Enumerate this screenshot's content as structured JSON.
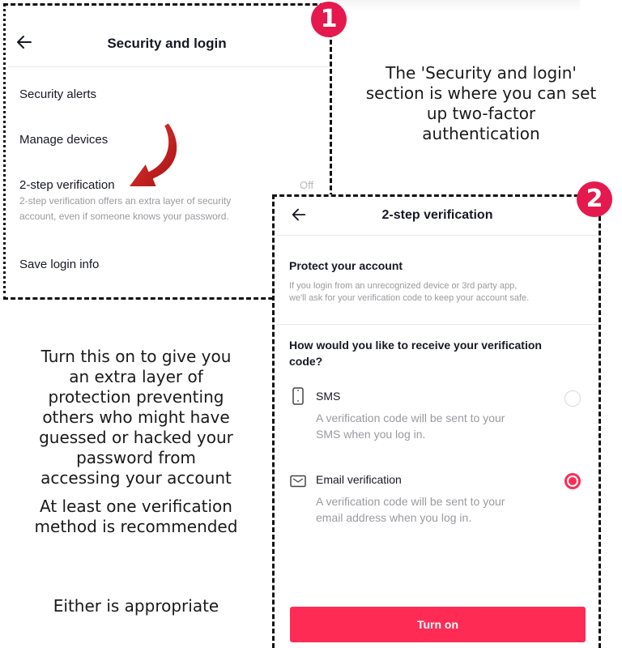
{
  "screen1": {
    "title": "Security and login",
    "items": [
      {
        "label": "Security alerts"
      },
      {
        "label": "Manage devices"
      },
      {
        "label": "2-step verification",
        "value": "Off",
        "description_line1": "2-step verification offers an extra layer of security",
        "description_line2": "account, even if someone knows your password."
      },
      {
        "label": "Save login info"
      }
    ]
  },
  "badges": {
    "one": "1",
    "two": "2"
  },
  "captions": {
    "security_section": [
      "The 'Security and login'",
      "section is where you can set",
      "up two-factor",
      "authentication"
    ],
    "turn_on_help": [
      "Turn this on to give you",
      "an extra layer of",
      "protection preventing",
      "others who might have",
      "guessed or hacked your",
      "password from",
      "accessing your account"
    ],
    "recommended": [
      "At least one verification",
      "method is recommended"
    ],
    "either": "Either is appropriate"
  },
  "screen2": {
    "title": "2-step verification",
    "protect_heading": "Protect your account",
    "protect_text": [
      "If you login from an unrecognized device or 3rd party app,",
      "we'll ask for your verification code to keep your account safe."
    ],
    "question": [
      "How would you like to receive your verification",
      "code?"
    ],
    "options": [
      {
        "title": "SMS",
        "desc": [
          "A verification code will be sent to your",
          "SMS when you log in."
        ],
        "selected": false,
        "icon": "phone-icon"
      },
      {
        "title": "Email verification",
        "desc": [
          "A verification code will be sent to your",
          "email address when you log in."
        ],
        "selected": true,
        "icon": "envelope-icon"
      }
    ],
    "button": "Turn on"
  },
  "colors": {
    "accent": "#fe2c55",
    "badge": "#e5194d",
    "arrow": "#cc1a1a"
  }
}
